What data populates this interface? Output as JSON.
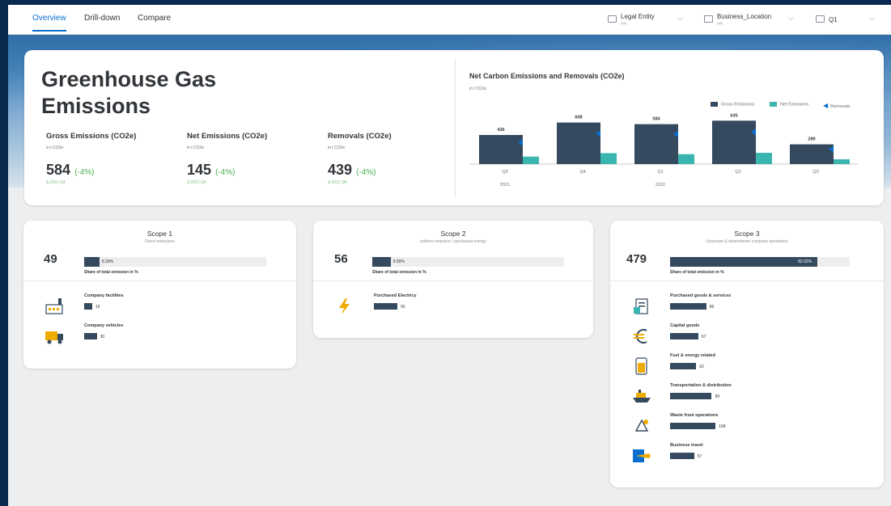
{
  "nav": {
    "tabs": [
      "Overview",
      "Drill-down",
      "Compare"
    ],
    "filters": [
      {
        "label": "Legal Entity",
        "sub": "(All)"
      },
      {
        "label": "Business_Location",
        "sub": "(All)"
      },
      {
        "label": "Q1",
        "sub": ""
      }
    ]
  },
  "summary": {
    "title_line1": "Greenhouse Gas",
    "title_line2": "Emissions",
    "kpis": [
      {
        "title": "Gross Emissions (CO2e)",
        "unit": "in t CO2e",
        "value": "584",
        "delta": "(-4%)",
        "compare": "Δ 2021 Q4"
      },
      {
        "title": "Net Emissions (CO2e)",
        "unit": "in t CO2e",
        "value": "145",
        "delta": "(-4%)",
        "compare": "Δ 2021 Q4"
      },
      {
        "title": "Removals (CO2e)",
        "unit": "in t CO2e",
        "value": "439",
        "delta": "(-4%)",
        "compare": "Δ 2021 Q4"
      }
    ]
  },
  "chart_data": {
    "type": "bar",
    "title": "Net Carbon Emissions and Removals (CO2e)",
    "unit": "in t CO2e",
    "categories": [
      "Q3",
      "Q4",
      "Q1",
      "Q2",
      "Q3"
    ],
    "year_groups": [
      {
        "label": "2021",
        "span": [
          0,
          1
        ]
      },
      {
        "label": "2022",
        "span": [
          2,
          4
        ]
      }
    ],
    "legend": [
      "Gross Emissions",
      "Net Emissions",
      "Removals"
    ],
    "legend_position": "top-right",
    "series": [
      {
        "name": "Gross Emissions",
        "values": [
          426,
          608,
          584,
          635,
          289
        ],
        "color": "#354a5f",
        "labeled": true
      },
      {
        "name": "Net Emissions",
        "values": [
          110,
          160,
          145,
          165,
          70
        ],
        "color": "#3ab5b0"
      },
      {
        "name": "Removals",
        "values": [
          316,
          448,
          439,
          470,
          219
        ],
        "color": "#0a6ed1",
        "marker": "triangle-left"
      }
    ],
    "ylim": [
      0,
      700
    ],
    "grid": false
  },
  "scopes": [
    {
      "title": "Scope 1",
      "subtitle": "Direct emissions",
      "value": "49",
      "share": "8.39%",
      "share_pct": 8.39,
      "share_label": "Share of total emission in %",
      "items": [
        {
          "label": "Company facilities",
          "value": 19,
          "icon": "factory-icon"
        },
        {
          "label": "Company vehicles",
          "value": 30,
          "icon": "truck-icon"
        }
      ]
    },
    {
      "title": "Scope 2",
      "subtitle": "Indirect emission / purchased energy",
      "value": "56",
      "share": "9.59%",
      "share_pct": 9.59,
      "share_label": "Share of total emission in %",
      "items": [
        {
          "label": "Purchased Electricy",
          "value": 56,
          "icon": "lightning-icon"
        }
      ]
    },
    {
      "title": "Scope 3",
      "subtitle": "Upstream & downstream company operations",
      "value": "479",
      "share": "82.02%",
      "share_pct": 82.02,
      "share_label": "Share of total emission in %",
      "items": [
        {
          "label": "Purchased goods & services",
          "value": 86,
          "icon": "invoice-icon"
        },
        {
          "label": "Capital goods",
          "value": 67,
          "icon": "euro-icon"
        },
        {
          "label": "Fuel & energy related",
          "value": 62,
          "icon": "fuel-icon"
        },
        {
          "label": "Transportation & distribution",
          "value": 99,
          "icon": "ship-icon"
        },
        {
          "label": "Waste from operations",
          "value": 108,
          "icon": "recycle-icon"
        },
        {
          "label": "Business travel",
          "value": 57,
          "icon": "plane-icon"
        }
      ]
    }
  ],
  "colors": {
    "accent": "#0a6ed1",
    "bar_dark": "#354a5f",
    "teal": "#3ab5b0",
    "positive": "#4caf50"
  }
}
